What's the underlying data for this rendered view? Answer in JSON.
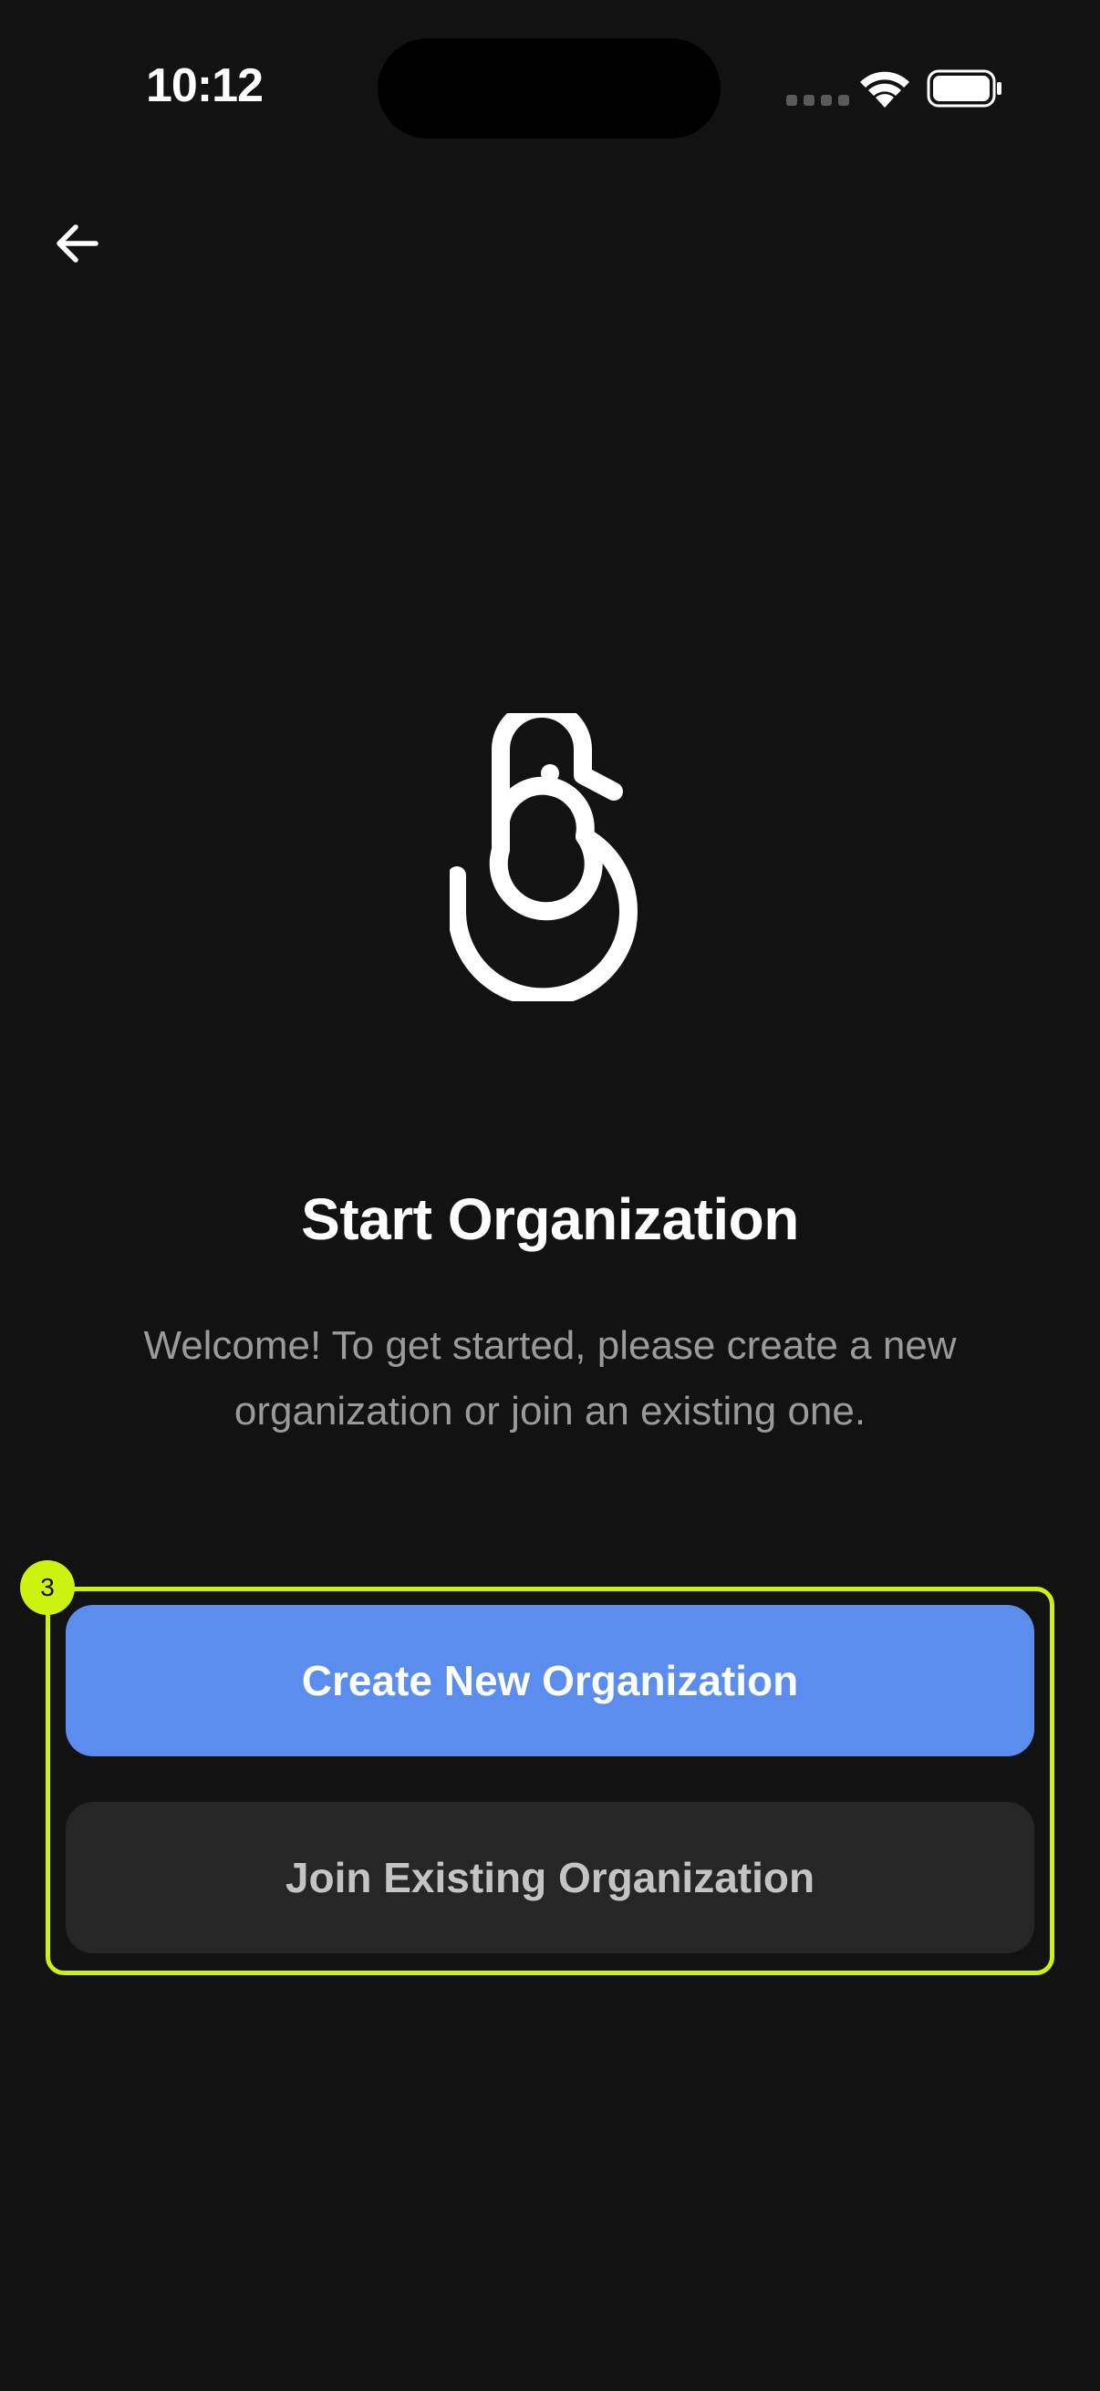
{
  "status_bar": {
    "time": "10:12"
  },
  "header": {
    "back_icon": "arrow-left-icon"
  },
  "logo": {
    "icon": "swan-logo-icon"
  },
  "content": {
    "title": "Start Organization",
    "subtitle": "Welcome! To get started, please create a new organization or join an existing one."
  },
  "highlight": {
    "badge": "3",
    "color": "#ccf20f"
  },
  "actions": {
    "create_label": "Create New Organization",
    "join_label": "Join Existing Organization"
  },
  "colors": {
    "background": "#121212",
    "primary": "#5b8dee",
    "secondary": "#262626"
  }
}
